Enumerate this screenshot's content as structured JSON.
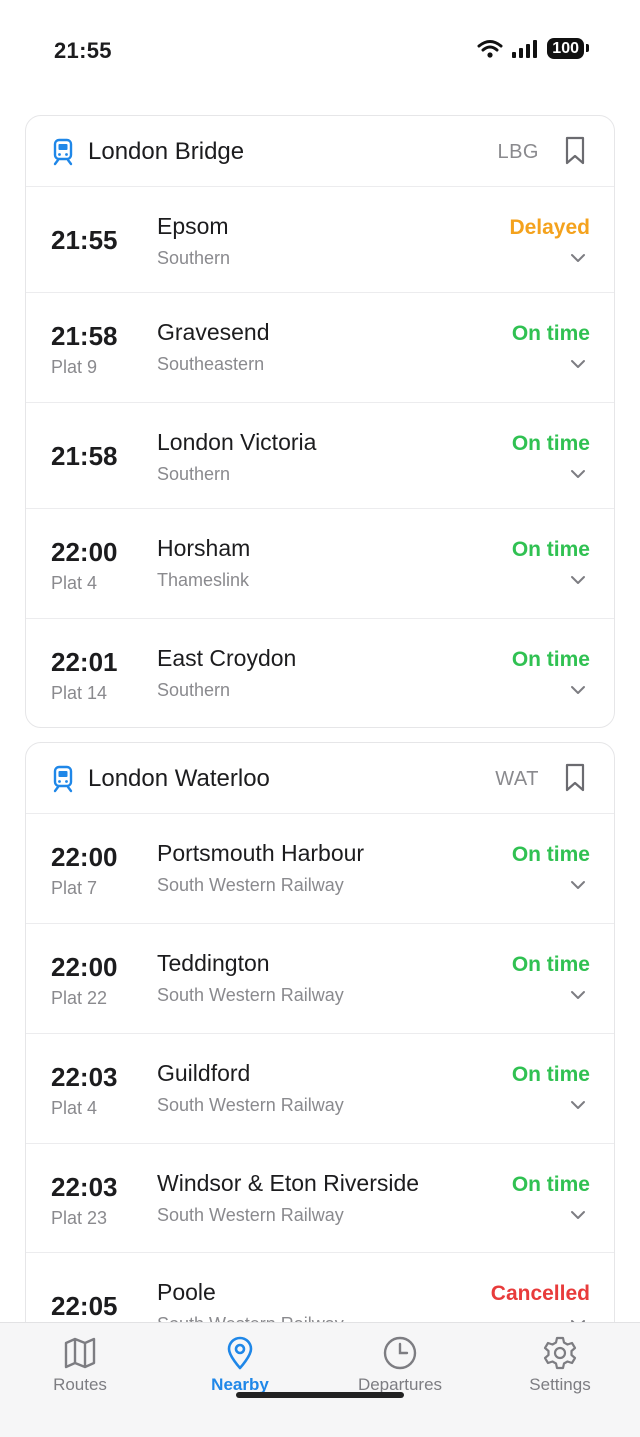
{
  "status_bar": {
    "time": "21:55",
    "battery": "100"
  },
  "colors": {
    "accent": "#1f87e8",
    "on_time": "#30c152",
    "delayed": "#f4a21d",
    "cancelled": "#e83b3b",
    "muted": "#8a8a8e"
  },
  "stations": [
    {
      "name": "London Bridge",
      "code": "LBG",
      "icon": "train-icon",
      "departures": [
        {
          "time": "21:55",
          "platform": "",
          "destination": "Epsom",
          "operator": "Southern",
          "status": "Delayed",
          "status_kind": "delayed"
        },
        {
          "time": "21:58",
          "platform": "Plat 9",
          "destination": "Gravesend",
          "operator": "Southeastern",
          "status": "On time",
          "status_kind": "on_time"
        },
        {
          "time": "21:58",
          "platform": "",
          "destination": "London Victoria",
          "operator": "Southern",
          "status": "On time",
          "status_kind": "on_time"
        },
        {
          "time": "22:00",
          "platform": "Plat 4",
          "destination": "Horsham",
          "operator": "Thameslink",
          "status": "On time",
          "status_kind": "on_time"
        },
        {
          "time": "22:01",
          "platform": "Plat 14",
          "destination": "East Croydon",
          "operator": "Southern",
          "status": "On time",
          "status_kind": "on_time"
        }
      ]
    },
    {
      "name": "London Waterloo",
      "code": "WAT",
      "icon": "train-icon",
      "departures": [
        {
          "time": "22:00",
          "platform": "Plat 7",
          "destination": "Portsmouth Harbour",
          "operator": "South Western Railway",
          "status": "On time",
          "status_kind": "on_time"
        },
        {
          "time": "22:00",
          "platform": "Plat 22",
          "destination": "Teddington",
          "operator": "South Western Railway",
          "status": "On time",
          "status_kind": "on_time"
        },
        {
          "time": "22:03",
          "platform": "Plat 4",
          "destination": "Guildford",
          "operator": "South Western Railway",
          "status": "On time",
          "status_kind": "on_time"
        },
        {
          "time": "22:03",
          "platform": "Plat 23",
          "destination": "Windsor & Eton Riverside",
          "operator": "South Western Railway",
          "status": "On time",
          "status_kind": "on_time"
        },
        {
          "time": "22:05",
          "platform": "",
          "destination": "Poole",
          "operator": "South Western Railway",
          "status": "Cancelled",
          "status_kind": "cancelled"
        }
      ]
    }
  ],
  "tab_bar": {
    "tabs": [
      {
        "label": "Routes",
        "icon": "map-icon",
        "active": false
      },
      {
        "label": "Nearby",
        "icon": "location-pin-icon",
        "active": true
      },
      {
        "label": "Departures",
        "icon": "clock-icon",
        "active": false
      },
      {
        "label": "Settings",
        "icon": "gear-icon",
        "active": false
      }
    ]
  }
}
